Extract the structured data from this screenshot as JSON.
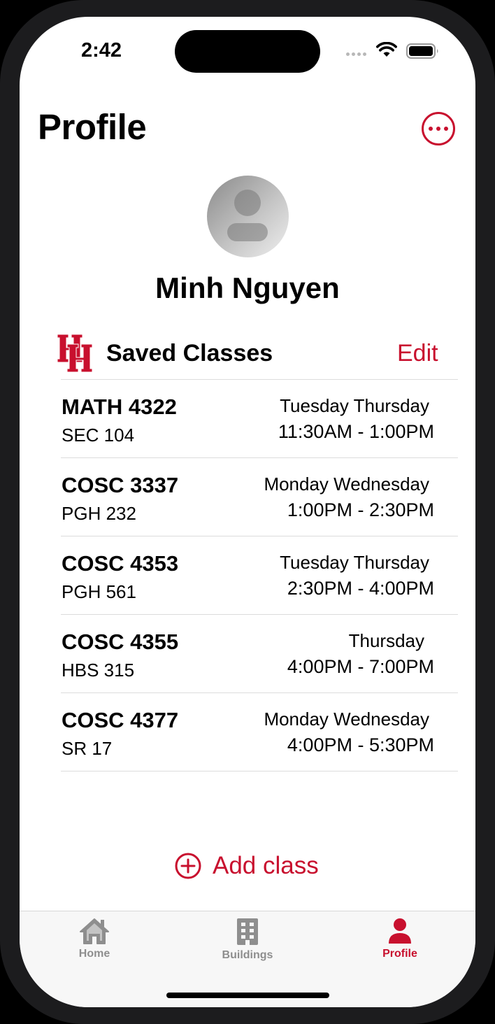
{
  "status_bar": {
    "time": "2:42"
  },
  "header": {
    "title": "Profile",
    "more_icon": "ellipsis-circle-icon"
  },
  "profile": {
    "name": "Minh Nguyen"
  },
  "saved_classes": {
    "title": "Saved Classes",
    "edit_label": "Edit",
    "items": [
      {
        "code": "MATH 4322",
        "room": "SEC 104",
        "days": "Tuesday Thursday",
        "time": "11:30AM - 1:00PM"
      },
      {
        "code": "COSC 3337",
        "room": "PGH 232",
        "days": "Monday Wednesday",
        "time": "1:00PM - 2:30PM"
      },
      {
        "code": "COSC 4353",
        "room": "PGH 561",
        "days": "Tuesday Thursday",
        "time": "2:30PM - 4:00PM"
      },
      {
        "code": "COSC 4355",
        "room": "HBS 315",
        "days": "Thursday",
        "time": "4:00PM - 7:00PM"
      },
      {
        "code": "COSC 4377",
        "room": "SR 17",
        "days": "Monday Wednesday",
        "time": "4:00PM - 5:30PM"
      }
    ]
  },
  "add_class": {
    "label": "Add class"
  },
  "tabs": [
    {
      "label": "Home",
      "icon": "house-icon"
    },
    {
      "label": "Buildings",
      "icon": "building-icon"
    },
    {
      "label": "Profile",
      "icon": "person-icon"
    }
  ],
  "colors": {
    "accent": "#c8102e",
    "inactive": "#8e8e8e"
  }
}
